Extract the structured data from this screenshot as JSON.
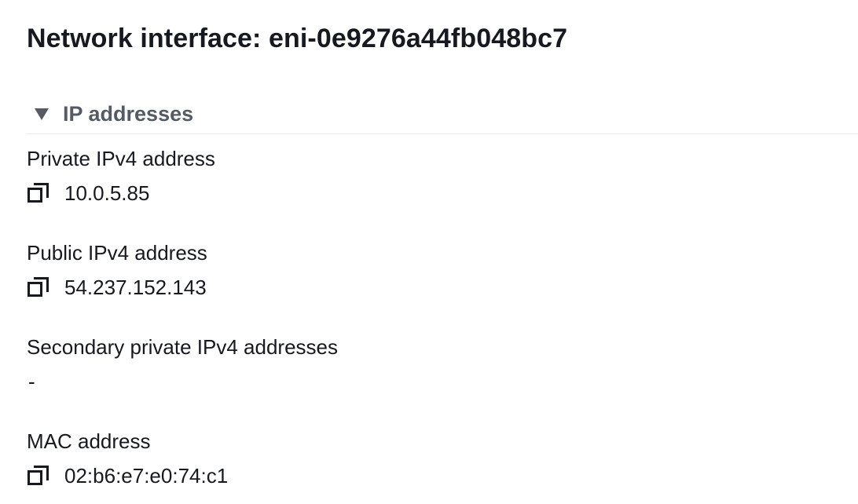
{
  "header": {
    "title": "Network interface: eni-0e9276a44fb048bc7"
  },
  "section": {
    "title": "IP addresses",
    "caret_icon": "caret-down-icon",
    "fields": [
      {
        "label": "Private IPv4 address",
        "value": "10.0.5.85",
        "copyable": true
      },
      {
        "label": "Public IPv4 address",
        "value": "54.237.152.143",
        "copyable": true
      },
      {
        "label": "Secondary private IPv4 addresses",
        "value": "-",
        "copyable": false
      },
      {
        "label": "MAC address",
        "value": "02:b6:e7:e0:74:c1",
        "copyable": true
      }
    ]
  },
  "colors": {
    "text": "#16191f",
    "section_header": "#545b64",
    "divider": "#eaeded",
    "background": "#ffffff"
  },
  "icons": {
    "copy": "copy-icon"
  }
}
